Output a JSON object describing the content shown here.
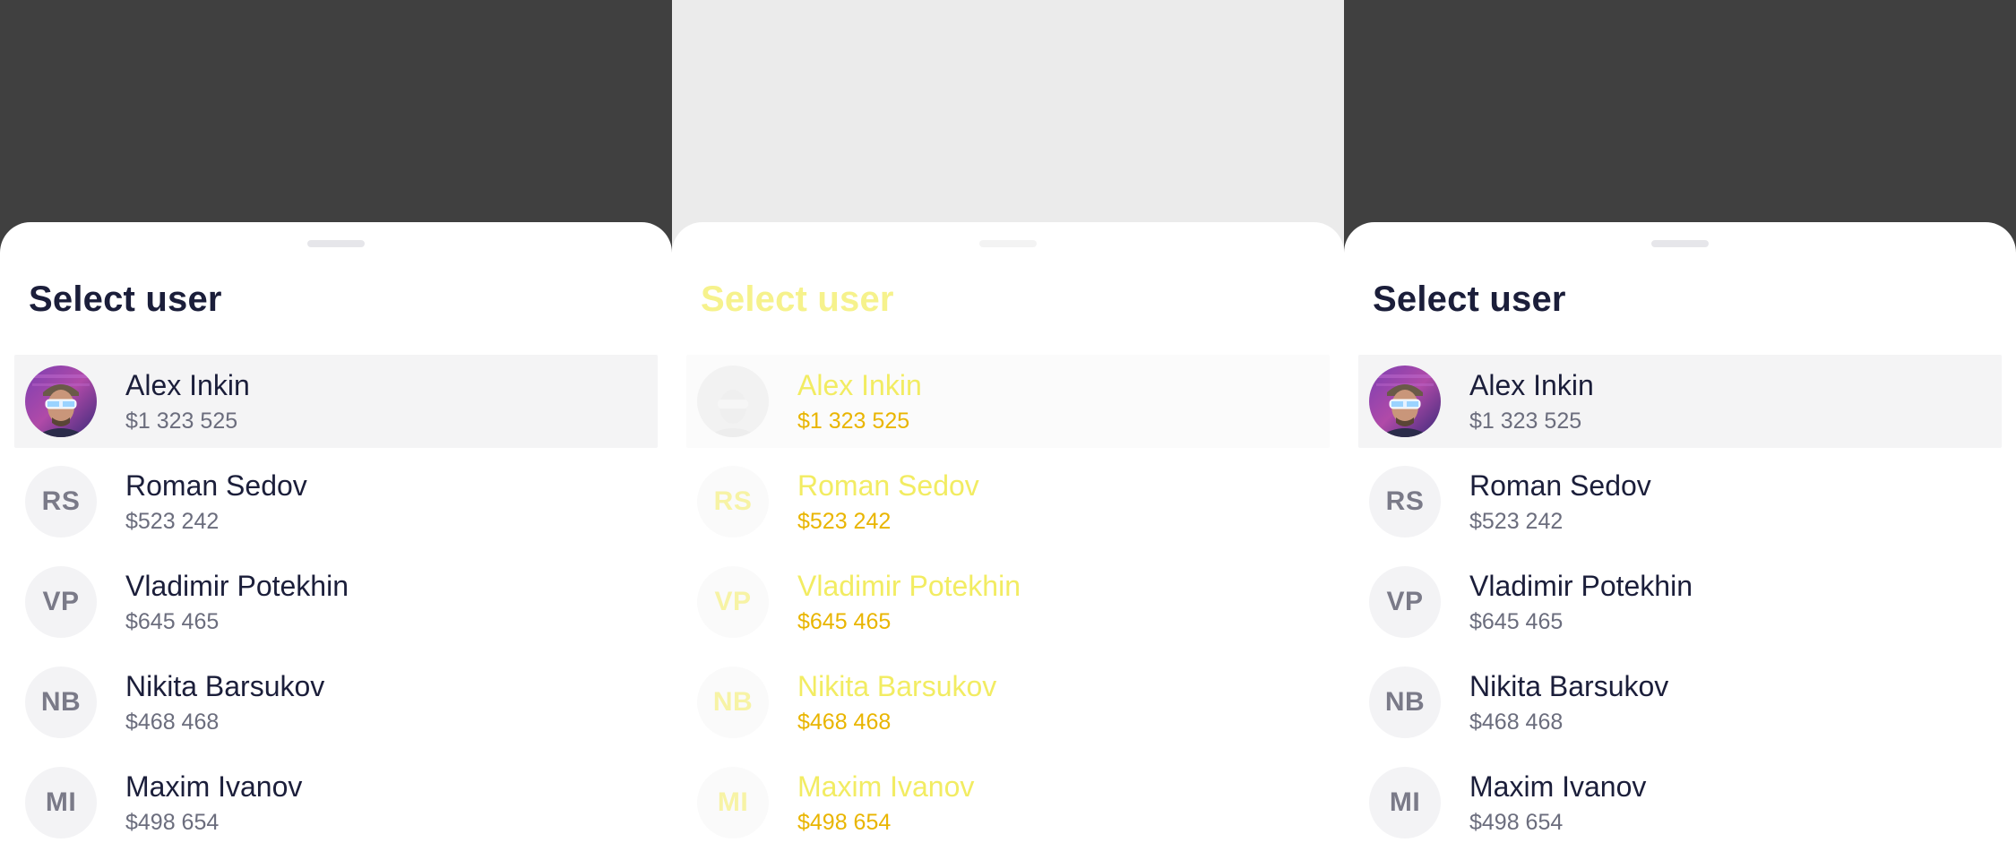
{
  "sheet": {
    "title": "Select user"
  },
  "users": [
    {
      "name": "Alex Inkin",
      "balance": "$1 323 525",
      "initials": "",
      "avatar": "photo-avatar",
      "selected": true
    },
    {
      "name": "Roman Sedov",
      "balance": "$523 242",
      "initials": "RS",
      "avatar": "initials-avatar",
      "selected": false
    },
    {
      "name": "Vladimir Potekhin",
      "balance": "$645 465",
      "initials": "VP",
      "avatar": "initials-avatar",
      "selected": false
    },
    {
      "name": "Nikita Barsukov",
      "balance": "$468 468",
      "initials": "NB",
      "avatar": "initials-avatar",
      "selected": false
    },
    {
      "name": "Maxim Ivanov",
      "balance": "$498 654",
      "initials": "MI",
      "avatar": "initials-avatar",
      "selected": false
    }
  ],
  "colors": {
    "backdrop_dark": "#404040",
    "backdrop_light": "#ebebeb",
    "sheet": "#ffffff",
    "title": "#1b1e3a",
    "secondary_text": "#6b6d7d",
    "selected_row": "#f4f4f5",
    "avatar_bg": "#f3f3f5",
    "overlay_text_yellow": "#f2ec62",
    "overlay_text_orange": "#e9b500"
  }
}
